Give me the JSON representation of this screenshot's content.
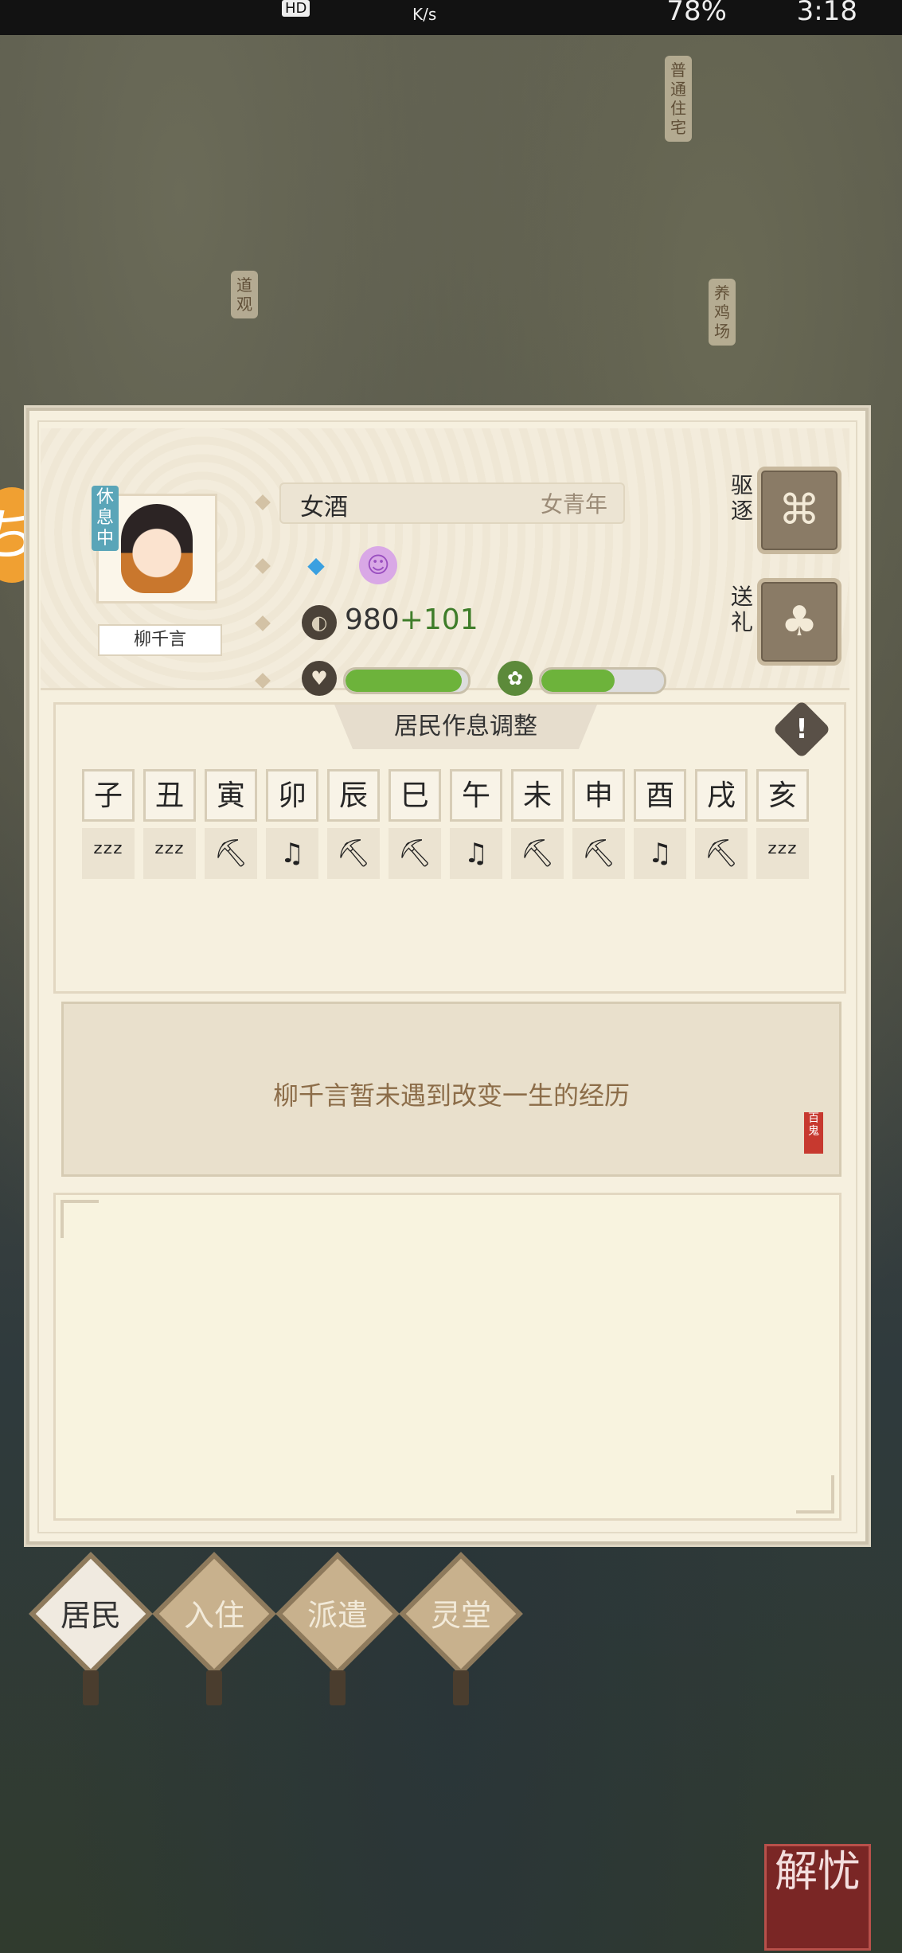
{
  "status_bar": {
    "speed": "K/s",
    "hd": "HD",
    "battery": "78%",
    "time": "3:18"
  },
  "map_labels": [
    "普通住宅",
    "道观",
    "养鸡场"
  ],
  "resident": {
    "status_tag": "休息中",
    "name": "柳千言",
    "job": "女酒",
    "age_group": "女青年",
    "money": "980",
    "money_gain": "+101",
    "health": 0.95,
    "mood": 0.6
  },
  "side_buttons": [
    {
      "label": "驱逐",
      "icon": "broom-icon"
    },
    {
      "label": "送礼",
      "icon": "gift-bag-icon"
    }
  ],
  "schedule": {
    "title": "居民作息调整",
    "hours": [
      "子",
      "丑",
      "寅",
      "卯",
      "辰",
      "巳",
      "午",
      "未",
      "申",
      "酉",
      "戌",
      "亥"
    ],
    "activities": [
      "sleep",
      "sleep",
      "work",
      "leisure",
      "work",
      "work",
      "leisure",
      "work",
      "work",
      "leisure",
      "work",
      "sleep"
    ]
  },
  "life_event": {
    "text": "柳千言暂未遇到改变一生的经历",
    "seal": "百鬼"
  },
  "tabs": [
    {
      "label": "居民",
      "active": true
    },
    {
      "label": "入住",
      "active": false
    },
    {
      "label": "派遣",
      "active": false
    },
    {
      "label": "灵堂",
      "active": false
    }
  ],
  "dismiss_button": "解忧",
  "colors": {
    "accent_green": "#6db33b",
    "panel_bg": "#f6f0df",
    "tab_brown": "#c8b18d"
  }
}
